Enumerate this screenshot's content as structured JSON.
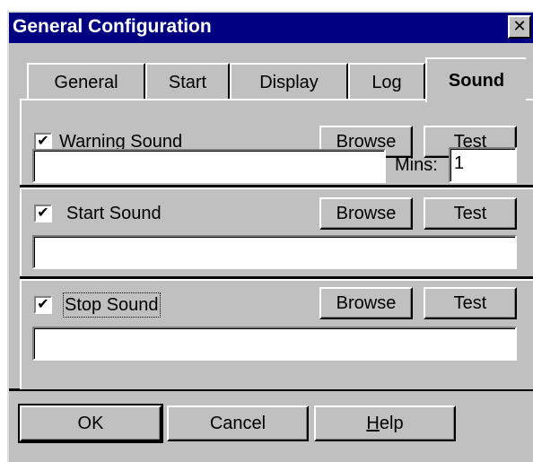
{
  "window": {
    "title": "General Configuration",
    "close_glyph": "✕",
    "close_icon": "close-icon"
  },
  "tabs": [
    {
      "label": "General",
      "active": false
    },
    {
      "label": "Start",
      "active": false
    },
    {
      "label": "Display",
      "active": false
    },
    {
      "label": "Log",
      "active": false
    },
    {
      "label": "Sound",
      "active": true
    }
  ],
  "sections": {
    "warning": {
      "checkbox_label": "Warning Sound",
      "checked": true,
      "browse_label": "Browse",
      "test_label": "Test",
      "path_value": "",
      "mins_label": "Mins:",
      "mins_value": "1"
    },
    "start": {
      "checkbox_label": "Start Sound",
      "checked": true,
      "browse_label": "Browse",
      "test_label": "Test",
      "path_value": ""
    },
    "stop": {
      "checkbox_label": "Stop Sound",
      "checked": true,
      "browse_label": "Browse",
      "test_label": "Test",
      "path_value": ""
    }
  },
  "checkmark_glyph": "✔",
  "footer": {
    "ok_label": "OK",
    "cancel_label": "Cancel",
    "help_label_rest": "elp",
    "help_label_mnemonic": "H"
  },
  "colors": {
    "titlebar": "#000080",
    "face": "#c0c0c0"
  }
}
